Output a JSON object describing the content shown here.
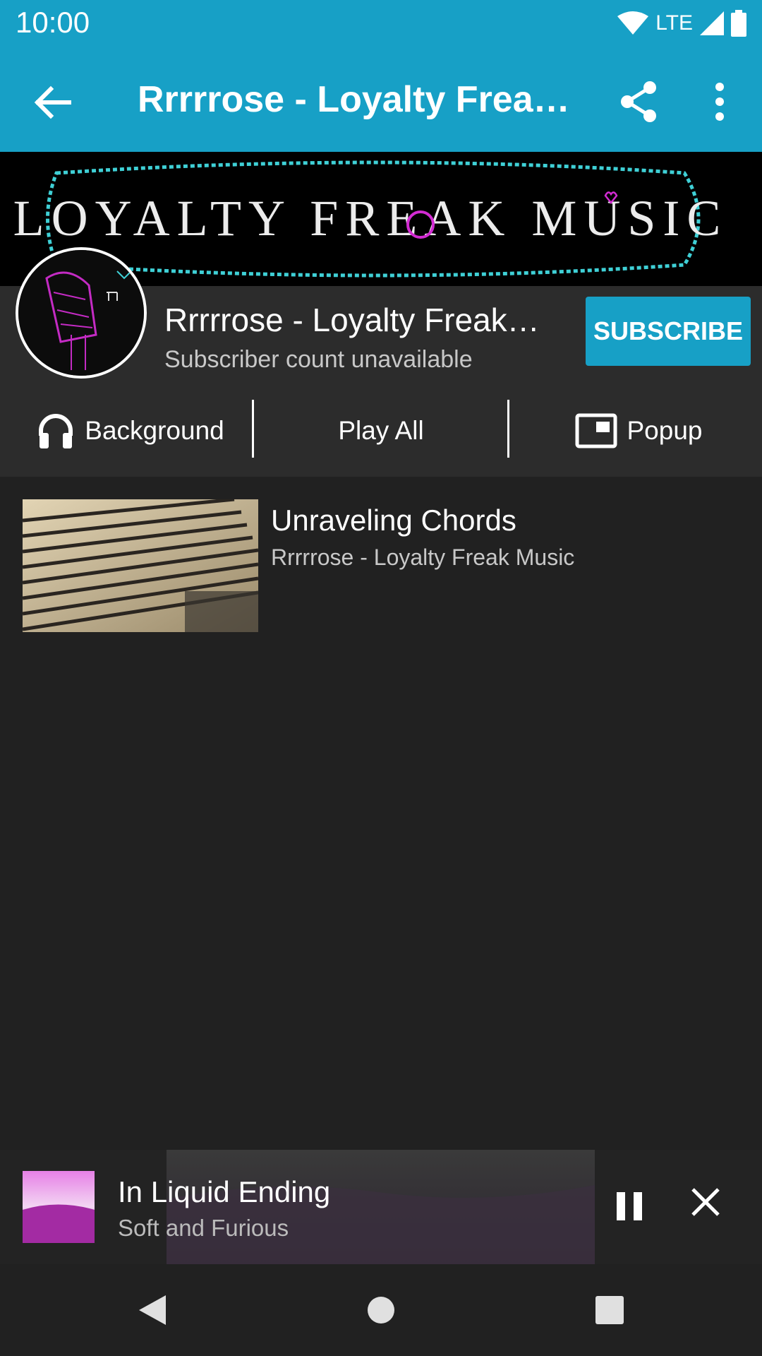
{
  "status_bar": {
    "time": "10:00",
    "network": "LTE"
  },
  "app_bar": {
    "title": "Rrrrrose - Loyalty Freak Music"
  },
  "banner": {
    "logo_text": "LOYALTY FREAK MUSIC"
  },
  "channel": {
    "name": "Rrrrrose - Loyalty Freak Music",
    "subscriber_text": "Subscriber count unavailable",
    "subscribe_label": "SUBSCRIBE"
  },
  "actions": {
    "background_label": "Background",
    "play_all_label": "Play All",
    "popup_label": "Popup"
  },
  "videos": [
    {
      "title": "Unraveling Chords",
      "uploader": "Rrrrrose - Loyalty Freak Music"
    }
  ],
  "mini_player": {
    "title": "In Liquid Ending",
    "artist": "Soft and Furious"
  },
  "colors": {
    "accent": "#17a0c6",
    "background": "#212121",
    "header": "#2c2c2c"
  }
}
